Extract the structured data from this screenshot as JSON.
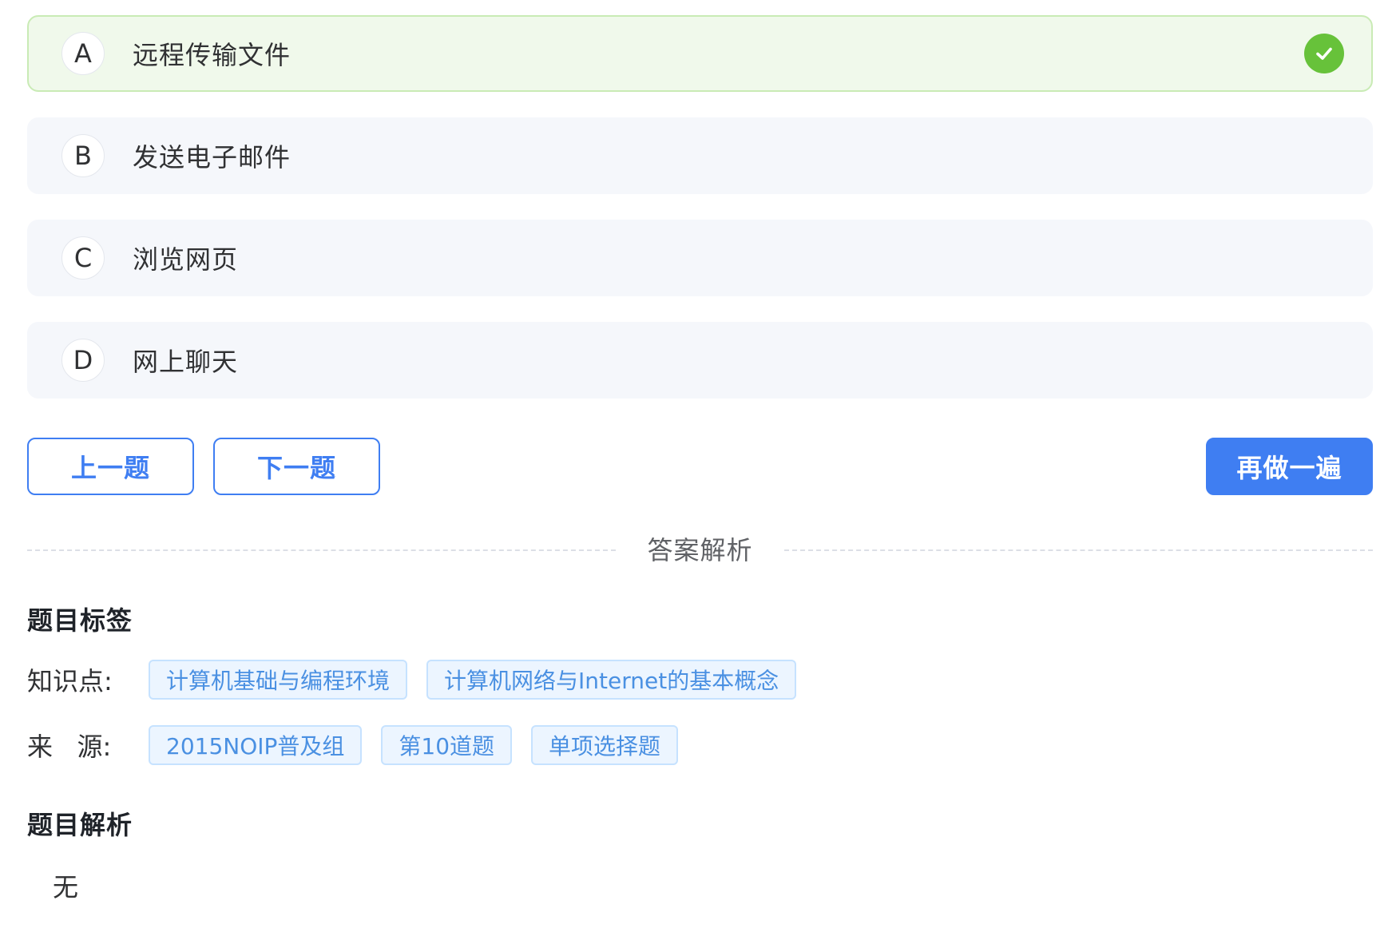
{
  "options": [
    {
      "letter": "A",
      "text": "远程传输文件",
      "correct": true
    },
    {
      "letter": "B",
      "text": "发送电子邮件",
      "correct": false
    },
    {
      "letter": "C",
      "text": "浏览网页",
      "correct": false
    },
    {
      "letter": "D",
      "text": "网上聊天",
      "correct": false
    }
  ],
  "actions": {
    "prev_label": "上一题",
    "next_label": "下一题",
    "redo_label": "再做一遍"
  },
  "divider": {
    "label": "答案解析"
  },
  "tags_section": {
    "title": "题目标签",
    "knowledge_label": "知识点:",
    "knowledge_tags": [
      "计算机基础与编程环境",
      "计算机网络与Internet的基本概念"
    ],
    "source_label": "来   源:",
    "source_tags": [
      "2015NOIP普及组",
      "第10道题",
      "单项选择题"
    ]
  },
  "analysis_section": {
    "title": "题目解析",
    "content": "无"
  },
  "colors": {
    "primary": "#3f7ef2",
    "correct": "#67c23a",
    "correct_bg": "#f0f9eb",
    "option_bg": "#f5f7fb",
    "tag_text": "#4a90e2",
    "tag_bg": "#ecf5ff"
  },
  "icons": {
    "correct_indicator": "check-circle-icon"
  }
}
